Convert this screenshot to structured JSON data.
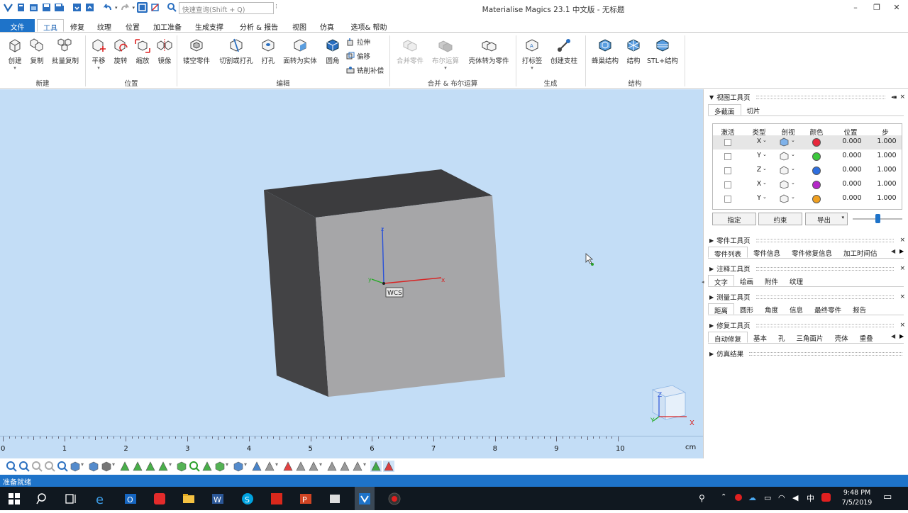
{
  "app": {
    "title": "Materialise Magics 23.1 中文版 - 无标题",
    "search_placeholder": "快速查询(Shift + Q)"
  },
  "tabs": [
    "文件",
    "工具",
    "修复",
    "纹理",
    "位置",
    "加工准备",
    "生成支撑",
    "分析 & 报告",
    "视图",
    "仿真",
    "选项& 帮助"
  ],
  "ribbon": {
    "new_group": {
      "label": "新建",
      "buttons": [
        "创建",
        "复制",
        "批量复制"
      ]
    },
    "position_group": {
      "label": "位置",
      "buttons": [
        "平移",
        "旋转",
        "缩放",
        "镜像"
      ]
    },
    "edit_group": {
      "label": "编辑",
      "buttons": [
        "镂空零件",
        "切割或打孔",
        "打孔",
        "面转为实体",
        "圆角"
      ],
      "small": [
        "拉伸",
        "偏移",
        "铣削补偿"
      ]
    },
    "boolean_group": {
      "label": "合并 & 布尔运算",
      "buttons": [
        "合并零件",
        "布尔运算",
        "壳体转为零件"
      ]
    },
    "generate_group": {
      "label": "生成",
      "buttons": [
        "打标签",
        "创建支柱"
      ]
    },
    "structure_group": {
      "label": "结构",
      "buttons": [
        "蜂巢结构",
        "结构",
        "STL+结构"
      ]
    }
  },
  "viewport": {
    "wcs_label": "WCS",
    "axis_x": "x",
    "axis_y": "y",
    "axis_z": "z",
    "cube_axis_z": "Z",
    "cube_axis_y": "Y",
    "cube_axis_x": "X",
    "ruler": {
      "ticks": [
        "0",
        "1",
        "2",
        "3",
        "4",
        "5",
        "6",
        "7",
        "8",
        "9",
        "10"
      ],
      "unit": "cm"
    }
  },
  "panel": {
    "view_toolpage": {
      "title": "视图工具页",
      "tabs": [
        "多截面",
        "切片"
      ],
      "columns": [
        "激活",
        "类型",
        "剖视",
        "颜色",
        "位置",
        "步"
      ],
      "rows": [
        {
          "type": "X",
          "color": "#e8283c",
          "position": "0.000",
          "step": "1.000"
        },
        {
          "type": "Y",
          "color": "#3cc83c",
          "position": "0.000",
          "step": "1.000"
        },
        {
          "type": "Z",
          "color": "#2e6fe0",
          "position": "0.000",
          "step": "1.000"
        },
        {
          "type": "X",
          "color": "#b428c8",
          "position": "0.000",
          "step": "1.000"
        },
        {
          "type": "Y",
          "color": "#f0a020",
          "position": "0.000",
          "step": "1.000"
        }
      ],
      "buttons": [
        "指定",
        "约束",
        "导出"
      ]
    },
    "part_toolpage": {
      "title": "零件工具页",
      "tabs": [
        "零件列表",
        "零件信息",
        "零件修复信息",
        "加工时间估"
      ]
    },
    "annotation_toolpage": {
      "title": "注释工具页",
      "tabs": [
        "文字",
        "绘画",
        "附件",
        "纹理"
      ]
    },
    "measure_toolpage": {
      "title": "测量工具页",
      "tabs": [
        "距离",
        "圆形",
        "角度",
        "信息",
        "最终零件",
        "报告"
      ]
    },
    "repair_toolpage": {
      "title": "修复工具页",
      "tabs": [
        "自动修复",
        "基本",
        "孔",
        "三角面片",
        "壳体",
        "重叠"
      ]
    },
    "simulation": {
      "title": "仿真结果"
    }
  },
  "status": {
    "text": "准备就绪"
  },
  "taskbar": {
    "time": "9:48 PM",
    "date": "7/5/2019",
    "ime": "中"
  }
}
